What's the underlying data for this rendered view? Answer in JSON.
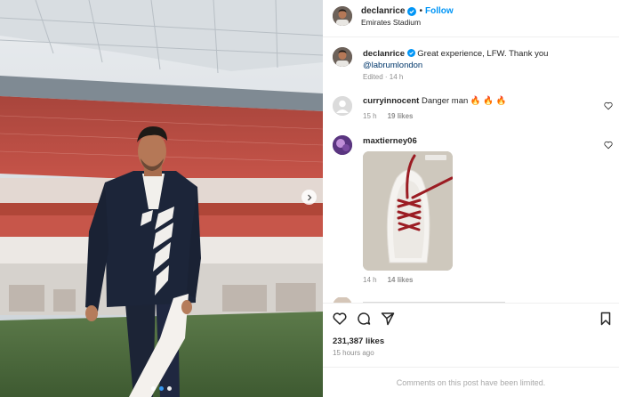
{
  "post": {
    "username": "declanrice",
    "follow_label": "Follow",
    "location": "Emirates Stadium",
    "caption_text": "Great experience, LFW. Thank you",
    "caption_mention": "@labrumlondon",
    "caption_meta": "Edited · 14 h",
    "likes": "231,387 likes",
    "posted_ago": "15 hours ago",
    "comments_limited": "Comments on this post have been limited."
  },
  "comments": [
    {
      "username": "curryinnocent",
      "text": "Danger man 🔥 🔥 🔥",
      "age": "15 h",
      "likes": "19 likes"
    },
    {
      "username": "maxtierney06",
      "text": "",
      "age": "14 h",
      "likes": "14 likes"
    }
  ],
  "icons": {
    "verified": "verified-badge-icon",
    "like": "heart-icon",
    "comment": "comment-bubble-icon",
    "share": "paper-plane-icon",
    "save": "bookmark-icon",
    "next": "chevron-right-icon"
  },
  "colors": {
    "accent": "#0095f6",
    "verified": "#0095f6",
    "carousel_active": "#3897f0"
  }
}
